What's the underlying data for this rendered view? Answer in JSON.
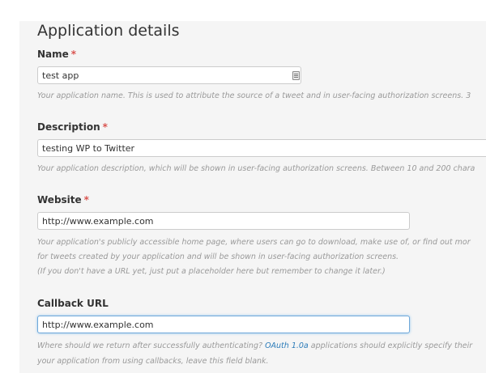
{
  "section_title": "Application details",
  "required_mark": "*",
  "fields": {
    "name": {
      "label": "Name",
      "value": "test app",
      "help": "Your application name. This is used to attribute the source of a tweet and in user-facing authorization screens. 3"
    },
    "description": {
      "label": "Description",
      "value": "testing WP to Twitter",
      "help": "Your application description, which will be shown in user-facing authorization screens. Between 10 and 200 chara"
    },
    "website": {
      "label": "Website",
      "value": "http://www.example.com",
      "help_line1": "Your application's publicly accessible home page, where users can go to download, make use of, or find out mor",
      "help_line2": "for tweets created by your application and will be shown in user-facing authorization screens.",
      "help_line3": "(If you don't have a URL yet, just put a placeholder here but remember to change it later.)"
    },
    "callback": {
      "label": "Callback URL",
      "value": "http://www.example.com",
      "help_line1_before": "Where should we return after successfully authenticating?",
      "help_link": "OAuth 1.0a",
      "help_line1_after": "applications should explicitly specify their",
      "help_line2": "your application from using callbacks, leave this field blank."
    }
  },
  "colors": {
    "required": "#d9534f",
    "link": "#2b7bb9",
    "focus_border": "#6fa7d9"
  }
}
